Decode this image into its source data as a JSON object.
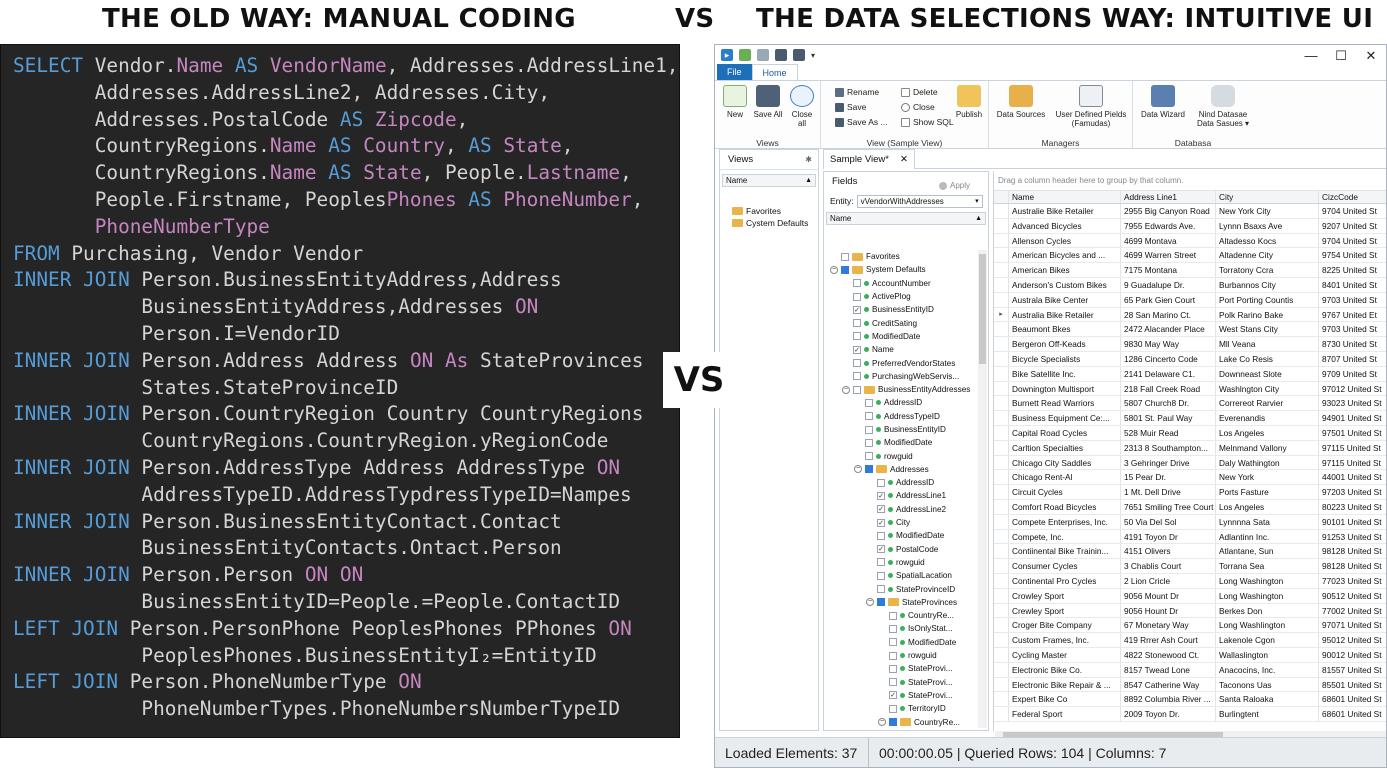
{
  "headings": {
    "left": "THE OLD WAY: MANUAL CODING",
    "vs": "VS",
    "right": "THE DATA SELECTIONS WAY: INTUITIVE UI",
    "vs_middle": "VS"
  },
  "code_lines": [
    [
      [
        "kw",
        "SELECT "
      ],
      [
        "t",
        "Vendor."
      ],
      [
        "mg",
        "Name"
      ],
      [
        "kw",
        " AS "
      ],
      [
        "mg",
        "VendorName"
      ],
      [
        "t",
        ", Addresses.AddressLine1,"
      ]
    ],
    [
      [
        "t",
        "       Addresses.AddressLine2, Addresses.City,"
      ]
    ],
    [
      [
        "t",
        "       Addresses.PostalCode "
      ],
      [
        "kw",
        "AS "
      ],
      [
        "mg",
        "Zipcode"
      ],
      [
        "t",
        ","
      ]
    ],
    [
      [
        "t",
        "       CountryRegions."
      ],
      [
        "mg",
        "Name"
      ],
      [
        "kw",
        " AS "
      ],
      [
        "mg",
        "Country"
      ],
      [
        "t",
        ", "
      ],
      [
        "kw",
        "AS "
      ],
      [
        "mg",
        "State"
      ],
      [
        "t",
        ","
      ]
    ],
    [
      [
        "t",
        "       CountryRegions."
      ],
      [
        "mg",
        "Name"
      ],
      [
        "kw",
        " AS "
      ],
      [
        "mg",
        "State"
      ],
      [
        "t",
        ", People."
      ],
      [
        "mg",
        "Lastname"
      ],
      [
        "t",
        ","
      ]
    ],
    [
      [
        "t",
        "       People.Firstname, Peoples"
      ],
      [
        "mg",
        "Phones"
      ],
      [
        "kw",
        " AS "
      ],
      [
        "mg",
        "PhoneNumber"
      ],
      [
        "t",
        ","
      ]
    ],
    [
      [
        "t",
        "       "
      ],
      [
        "mg",
        "PhoneNumberType"
      ]
    ],
    [
      [
        "kw",
        "FROM "
      ],
      [
        "t",
        "Purchasing, Vendor Vendor"
      ]
    ],
    [
      [
        "kw",
        "INNER JOIN "
      ],
      [
        "t",
        "Person.BusinessEntityAddress,Address"
      ]
    ],
    [
      [
        "t",
        "           BusinessEntityAddress,Addresses "
      ],
      [
        "mg",
        "ON"
      ]
    ],
    [
      [
        "t",
        "           Person.I=VendorID"
      ]
    ],
    [
      [
        "kw",
        "INNER JOIN "
      ],
      [
        "t",
        "Person.Address Address "
      ],
      [
        "mg",
        "ON"
      ],
      [
        "t",
        " "
      ],
      [
        "mg",
        "As"
      ],
      [
        "t",
        " StateProvinces"
      ]
    ],
    [
      [
        "t",
        "           States.StateProvinceID"
      ]
    ],
    [
      [
        "kw",
        "INNER JOIN "
      ],
      [
        "t",
        "Person.CountryRegion Country CountryRegions"
      ]
    ],
    [
      [
        "t",
        "           CountryRegions.CountryRegion.yRegionCode"
      ]
    ],
    [
      [
        "kw",
        "INNER JOIN "
      ],
      [
        "t",
        "Person.AddressType Address AddressType "
      ],
      [
        "mg",
        "ON"
      ]
    ],
    [
      [
        "t",
        "           AddressTypeID.AddressTypdressTypeID=Nampes"
      ]
    ],
    [
      [
        "kw",
        "INNER JOIN "
      ],
      [
        "t",
        "Person.BusinessEntityContact.Contact"
      ]
    ],
    [
      [
        "t",
        "           BusinessEntityContacts.Ontact.Person"
      ]
    ],
    [
      [
        "kw",
        "INNER JOIN "
      ],
      [
        "t",
        "Person.Person "
      ],
      [
        "mg",
        "ON"
      ],
      [
        "t",
        " "
      ],
      [
        "mg",
        "ON"
      ]
    ],
    [
      [
        "t",
        "           BusinessEntityID=People.=People.ContactID"
      ]
    ],
    [
      [
        "kw",
        "LEFT JOIN "
      ],
      [
        "t",
        "Person.PersonPhone PeoplesPhones PPhones "
      ],
      [
        "mg",
        "ON"
      ]
    ],
    [
      [
        "t",
        "           PeoplesPhones.BusinessEntityI₂=EntityID"
      ]
    ],
    [
      [
        "kw",
        "LEFT JOIN "
      ],
      [
        "t",
        "Person.PhoneNumberType "
      ],
      [
        "mg",
        "ON"
      ]
    ],
    [
      [
        "t",
        "           PhoneNumberTypes.PhoneNumbersNumberTypeID"
      ]
    ]
  ],
  "window_controls": {
    "minimize": "—",
    "maximize": "☐",
    "close": "✕"
  },
  "tabs": {
    "file": "File",
    "home": "Home"
  },
  "ribbon": {
    "new": "New",
    "save_all": "Save All",
    "close_all": "Close all",
    "rename": "Rename",
    "save": "Save",
    "save_as": "Save As ...",
    "delete": "Delete",
    "close": "Close",
    "show_sql": "Show SQL",
    "publish": "Publish",
    "data_sources": "Data Sources",
    "user_defined": "User Defined Pields (Famudas)",
    "data_wizard": "Data Wizard",
    "find_datasource": "Nind Datasae Data Sasues ▾",
    "group_views": "Views",
    "group_view_sample": "View (Sample View)",
    "group_managers": "Managers",
    "group_database": "Databasa"
  },
  "views_pane": {
    "title": "Views",
    "col": "Name",
    "items": [
      "Favorites",
      "Cystem Defaults"
    ]
  },
  "sample_tab": {
    "label": "Sample View*",
    "close": "✕"
  },
  "fields_pane": {
    "title": "Fields",
    "apply": "Apply",
    "entity_label": "Entity:",
    "entity_value": "vVendorWithAddresses",
    "col": "Name"
  },
  "tree": [
    {
      "lvl": 0,
      "exp": "",
      "cb": "",
      "ic": "folder",
      "t": "Favorites"
    },
    {
      "lvl": 0,
      "exp": "−",
      "cb": "part",
      "ic": "folder",
      "t": "System Defaults"
    },
    {
      "lvl": 1,
      "exp": "",
      "cb": "",
      "ic": "dot",
      "t": "AccountNumber"
    },
    {
      "lvl": 1,
      "exp": "",
      "cb": "",
      "ic": "dot",
      "t": "ActivePlog"
    },
    {
      "lvl": 1,
      "exp": "",
      "cb": "ck",
      "ic": "dot",
      "t": "BusinessEntityID"
    },
    {
      "lvl": 1,
      "exp": "",
      "cb": "",
      "ic": "dot",
      "t": "CreditSating"
    },
    {
      "lvl": 1,
      "exp": "",
      "cb": "",
      "ic": "dot",
      "t": "ModifiedDate"
    },
    {
      "lvl": 1,
      "exp": "",
      "cb": "ck",
      "ic": "dot",
      "t": "Name"
    },
    {
      "lvl": 1,
      "exp": "",
      "cb": "",
      "ic": "dot",
      "t": "PreferredVendorStates"
    },
    {
      "lvl": 1,
      "exp": "",
      "cb": "",
      "ic": "dot",
      "t": "PurchasingWebServis..."
    },
    {
      "lvl": 1,
      "exp": "−",
      "cb": "",
      "ic": "folder",
      "t": "BusinessEntityAddresses"
    },
    {
      "lvl": 2,
      "exp": "",
      "cb": "",
      "ic": "dot",
      "t": "AddressID"
    },
    {
      "lvl": 2,
      "exp": "",
      "cb": "",
      "ic": "dot",
      "t": "AddressTypeID"
    },
    {
      "lvl": 2,
      "exp": "",
      "cb": "",
      "ic": "dot",
      "t": "BusinessEntityID"
    },
    {
      "lvl": 2,
      "exp": "",
      "cb": "",
      "ic": "dot",
      "t": "ModifiedDate"
    },
    {
      "lvl": 2,
      "exp": "",
      "cb": "",
      "ic": "dot",
      "t": "rowguid"
    },
    {
      "lvl": 2,
      "exp": "−",
      "cb": "part",
      "ic": "folder",
      "t": "Addresses"
    },
    {
      "lvl": 3,
      "exp": "",
      "cb": "",
      "ic": "dot",
      "t": "AddressID"
    },
    {
      "lvl": 3,
      "exp": "",
      "cb": "ck",
      "ic": "dot",
      "t": "AddressLine1"
    },
    {
      "lvl": 3,
      "exp": "",
      "cb": "ck",
      "ic": "dot",
      "t": "AddressLine2"
    },
    {
      "lvl": 3,
      "exp": "",
      "cb": "ck",
      "ic": "dot",
      "t": "City"
    },
    {
      "lvl": 3,
      "exp": "",
      "cb": "",
      "ic": "dot",
      "t": "ModifiedDate"
    },
    {
      "lvl": 3,
      "exp": "",
      "cb": "ck",
      "ic": "dot",
      "t": "PostalCode"
    },
    {
      "lvl": 3,
      "exp": "",
      "cb": "",
      "ic": "dot",
      "t": "rowguid"
    },
    {
      "lvl": 3,
      "exp": "",
      "cb": "",
      "ic": "dot",
      "t": "SpatialLacation"
    },
    {
      "lvl": 3,
      "exp": "",
      "cb": "",
      "ic": "dot",
      "t": "StateProvinceID"
    },
    {
      "lvl": 3,
      "exp": "−",
      "cb": "part",
      "ic": "folder",
      "t": "StateProvinces"
    },
    {
      "lvl": 4,
      "exp": "",
      "cb": "",
      "ic": "dot",
      "t": "CountryRe..."
    },
    {
      "lvl": 4,
      "exp": "",
      "cb": "",
      "ic": "dot",
      "t": "IsOnlyStat..."
    },
    {
      "lvl": 4,
      "exp": "",
      "cb": "",
      "ic": "dot",
      "t": "ModifiedDate"
    },
    {
      "lvl": 4,
      "exp": "",
      "cb": "",
      "ic": "dot",
      "t": "rowguid"
    },
    {
      "lvl": 4,
      "exp": "",
      "cb": "",
      "ic": "dot",
      "t": "StateProvi..."
    },
    {
      "lvl": 4,
      "exp": "",
      "cb": "",
      "ic": "dot",
      "t": "StateProvi..."
    },
    {
      "lvl": 4,
      "exp": "",
      "cb": "ck",
      "ic": "dot",
      "t": "StateProvi..."
    },
    {
      "lvl": 4,
      "exp": "",
      "cb": "",
      "ic": "dot",
      "t": "TerritoryID"
    },
    {
      "lvl": 4,
      "exp": "−",
      "cb": "part",
      "ic": "folder",
      "t": "CountryRe..."
    },
    {
      "lvl": 5,
      "exp": "",
      "cb": "",
      "ic": "dot",
      "t": "Country..."
    }
  ],
  "grid": {
    "group_hint": "Drag a column header here to group by that column.",
    "headers": [
      "Name",
      "Address Line1",
      "City",
      "CizcCode"
    ],
    "rows": [
      [
        "Australie Bike Retailer",
        "2955 Big Canyon Road",
        "New York City",
        "9704 United St"
      ],
      [
        "Advanced Bicycles",
        "7955 Edwards Ave.",
        "Lynnn Bsaxs Ave",
        "9207 United St"
      ],
      [
        "Allenson Cycles",
        "4699 Montava",
        "Altadesso Kocs",
        "9704 United St"
      ],
      [
        "American Bicycles and ...",
        "4699 Warren Street",
        "Altadenne City",
        "9754 United St"
      ],
      [
        "American Bikes",
        "7175 Montana",
        "Torratony Ccra",
        "8225 United St"
      ],
      [
        "Anderson's Custom Bikes",
        "9 Guadalupe Dr.",
        "Burbannos City",
        "8401 United St"
      ],
      [
        "Australa Bike Center",
        "65 Park Gien Court",
        "Port Porting Countis",
        "9703 United St"
      ],
      [
        "Australia Bike Retailer",
        "28 San Marino Ct.",
        "Polk Rarino Bake",
        "9767 United Et"
      ],
      [
        "Beaumont Bkes",
        "2472 Alacander Place",
        "West Stans City",
        "9703 United St"
      ],
      [
        "Bergeron Off-Keads",
        "9830 May Way",
        "Mll Veana",
        "8730 United St"
      ],
      [
        "Bicycle Specialists",
        "1286 Cincerto Code",
        "Lake Co Resis",
        "8707 United St"
      ],
      [
        "Bike Satellite Inc.",
        "2141 Delaware C1.",
        "Downneast Slote",
        "9709 United St"
      ],
      [
        "Downington Multisport",
        "218 Fall Creek Road",
        "Washlngton City",
        "97012 United St"
      ],
      [
        "Burnett Read Warriors",
        "5807 Church8 Dr.",
        "Correreot Rarvier",
        "93023 United St"
      ],
      [
        "Business Equipment Ce:...",
        "5801 St. Paul Way",
        "Everenandis",
        "94901 United St"
      ],
      [
        "Capital Road Cycles",
        "528 Muir Read",
        "Los Angeles",
        "97501 United St"
      ],
      [
        "Carltion Specialties",
        "2313 8 Southampton...",
        "Melnmand Vallony",
        "97115 United St"
      ],
      [
        "Chicago City Saddles",
        "3 Gehringer Drive",
        "Daly Wathington",
        "97115 United St"
      ],
      [
        "Chicago Rent-Al",
        "15 Pear Dr.",
        "New York",
        "44001 United St"
      ],
      [
        "Circuit Cycles",
        "1 Mt. Dell Drive",
        "Ports Fasture",
        "97203 United St"
      ],
      [
        "Comfort Road Bicycles",
        "7651 Smiling Tree Court",
        "Los Angeles",
        "80223 United St"
      ],
      [
        "Compete Enterprises, Inc.",
        "50 Via Del Sol",
        "Lynnnna Sata",
        "90101 United St"
      ],
      [
        "Compete, Inc.",
        "4191 Toyon Dr",
        "Adlantinn Inc.",
        "91253 United St"
      ],
      [
        "Contiinental Bike Trainin...",
        "4151 Olivers",
        "Atlantane, Sun",
        "98128 United St"
      ],
      [
        "Consumer Cycles",
        "3 Chablis Court",
        "Torrana Sea",
        "98128 United St"
      ],
      [
        "Continental Pro Cycles",
        "2 Lion Cricle",
        "Long Washington",
        "77023 United St"
      ],
      [
        "Crowley Sport",
        "9056 Mount Dr",
        "Long Washington",
        "90512 United St"
      ],
      [
        "Crewley Sport",
        "9056 Hount Dr",
        "Berkes Don",
        "77002 United St"
      ],
      [
        "Croger Bite Company",
        "67 Monetary Way",
        "Long Washlington",
        "97071 United St"
      ],
      [
        "Custom Frames, Inc.",
        "419 Rrrer Ash Court",
        "Lakenole Cgon",
        "95012 United St"
      ],
      [
        "Cycling Master",
        "4822 Stonewood Ct.",
        "Wallaslington",
        "90012 United St"
      ],
      [
        "Electronic Bike Co.",
        "8157 Twead Lone",
        "Anacocins, Inc.",
        "81557 United St"
      ],
      [
        "Electronic Bike Repair & ...",
        "8547 Catherine Way",
        "Taconons Uas",
        "85501 United St"
      ],
      [
        "Expert Bike Co",
        "8892 Columbia River ...",
        "Santa Raloaka",
        "68601 United St"
      ],
      [
        "Federal Sport",
        "2009 Toyon Dr.",
        "Burlingtent",
        "68601 United St"
      ]
    ],
    "selected_row": 7
  },
  "status": {
    "left": "Loaded Elements: 37",
    "right": "00:00:00.05 | Queried Rows: 104 | Columns: 7"
  },
  "colors": {
    "code_bg": "#252526",
    "keyword": "#569cd6",
    "identifier": "#c586c0",
    "file_tab": "#1e6fba"
  }
}
